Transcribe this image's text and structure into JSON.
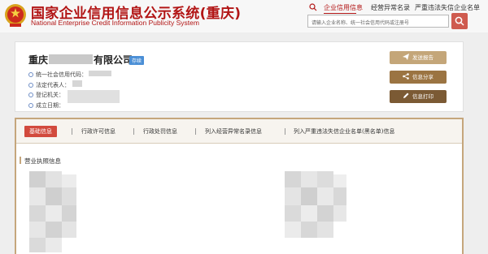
{
  "site": {
    "title": "国家企业信用信息公示系统(重庆)",
    "subtitle": "National Enterprise Credit Information Publicity System"
  },
  "nav": {
    "items": [
      {
        "label": "企业信用信息",
        "active": true
      },
      {
        "label": "经营异常名录",
        "active": false
      },
      {
        "label": "严重违法失信企业名单",
        "active": false
      }
    ]
  },
  "search": {
    "placeholder": "请输入企业名称、统一社会信用代码或注册号"
  },
  "company": {
    "name_prefix": "重庆",
    "name_suffix": "有限公司",
    "status": "存续",
    "fields": [
      {
        "label": "统一社会信用代码："
      },
      {
        "label": "法定代表人："
      },
      {
        "label": "登记机关："
      },
      {
        "label": "成立日期："
      }
    ]
  },
  "actions": {
    "send_report": "发送报告",
    "share": "信息分享",
    "print": "信息打印"
  },
  "tabs": [
    {
      "label": "基础信息",
      "active": true
    },
    {
      "label": "行政许可信息",
      "active": false
    },
    {
      "label": "行政处罚信息",
      "active": false
    },
    {
      "label": "列入经营异常名录信息",
      "active": false
    },
    {
      "label": "列入严重违法失信企业名单(黑名单)信息",
      "active": false
    }
  ],
  "section": {
    "title": "营业执照信息"
  },
  "colors": {
    "brand_red": "#b21515",
    "accent_gold": "#c5a67c",
    "active_tab": "#d24a3d"
  }
}
